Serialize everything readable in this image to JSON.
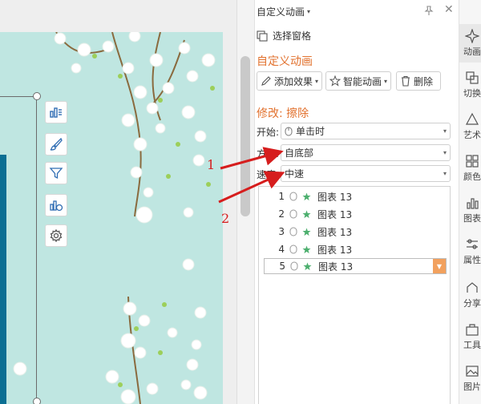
{
  "pane": {
    "title": "自定义动画",
    "selection_pane": "选择窗格",
    "heading": "自定义动画",
    "add_effect": "添加效果",
    "smart_animation": "智能动画",
    "delete": "删除",
    "modify_heading": "修改: 擦除",
    "start_label": "开始:",
    "start_value": "单击时",
    "direction_label": "方向:",
    "direction_value": "自底部",
    "speed_label": "速度:",
    "speed_value": "中速"
  },
  "animation_list": [
    {
      "num": "1",
      "name": "图表 13"
    },
    {
      "num": "2",
      "name": "图表 13"
    },
    {
      "num": "3",
      "name": "图表 13"
    },
    {
      "num": "4",
      "name": "图表 13"
    },
    {
      "num": "5",
      "name": "图表 13"
    }
  ],
  "annotations": {
    "one": "1",
    "two": "2"
  },
  "strip": {
    "animation": "动画",
    "transition": "切换",
    "art": "艺术",
    "color": "颜色",
    "chart": "图表",
    "property": "属性",
    "share": "分享",
    "tools": "工具",
    "image": "图片"
  },
  "colors": {
    "accent": "#e2722f",
    "arrow": "#d61d1d",
    "slide_bg": "#bfe6e1",
    "dark_bar": "#0a6f93"
  },
  "icons": [
    "chart-icon",
    "brush-icon",
    "filter-icon",
    "chart-settings-icon",
    "gear-icon",
    "pin-icon",
    "close-icon",
    "mouse-icon",
    "star-icon"
  ]
}
